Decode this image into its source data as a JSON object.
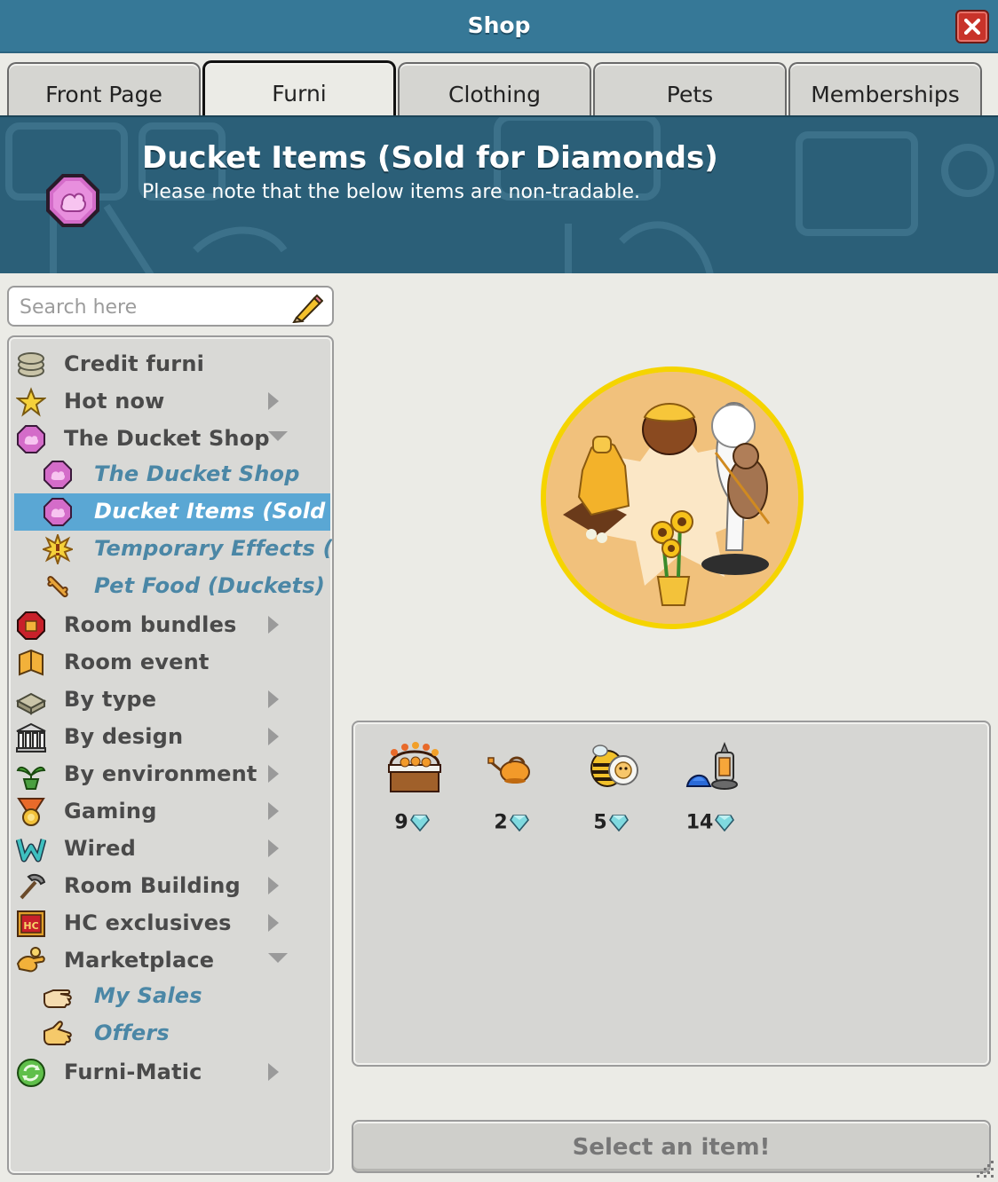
{
  "window": {
    "title": "Shop",
    "close_icon": "close-icon"
  },
  "tabs": [
    {
      "label": "Front Page",
      "active": false
    },
    {
      "label": "Furni",
      "active": true
    },
    {
      "label": "Clothing",
      "active": false
    },
    {
      "label": "Pets",
      "active": false
    },
    {
      "label": "Memberships",
      "active": false
    }
  ],
  "banner": {
    "title": "Ducket Items (Sold for Diamonds)",
    "subtitle": "Please note that the below items are non-tradable.",
    "icon": "ducket-icon"
  },
  "search": {
    "placeholder": "Search here",
    "value": "",
    "icon": "pencil-icon"
  },
  "categories": [
    {
      "label": "Credit furni",
      "icon": "credit-stack-icon",
      "arrow": "none",
      "level": 0
    },
    {
      "label": "Hot now",
      "icon": "star-icon",
      "arrow": "right",
      "level": 0
    },
    {
      "label": "The Ducket Shop",
      "icon": "ducket-icon",
      "arrow": "down",
      "level": 0
    },
    {
      "label": "The Ducket Shop",
      "icon": "ducket-icon",
      "arrow": "none",
      "level": 1
    },
    {
      "label": "Ducket Items (Sold for Diamonds)",
      "icon": "ducket-icon",
      "arrow": "none",
      "level": 1,
      "selected": true
    },
    {
      "label": "Temporary Effects (Duckets)",
      "icon": "burst-icon",
      "arrow": "none",
      "level": 1
    },
    {
      "label": "Pet Food (Duckets)",
      "icon": "bone-icon",
      "arrow": "none",
      "level": 1
    },
    {
      "label": "Room bundles",
      "icon": "bundle-icon",
      "arrow": "right",
      "level": 0
    },
    {
      "label": "Room event",
      "icon": "event-icon",
      "arrow": "none",
      "level": 0
    },
    {
      "label": "By type",
      "icon": "sofa-icon",
      "arrow": "right",
      "level": 0
    },
    {
      "label": "By design",
      "icon": "pillars-icon",
      "arrow": "right",
      "level": 0
    },
    {
      "label": "By environment",
      "icon": "plant-icon",
      "arrow": "right",
      "level": 0
    },
    {
      "label": "Gaming",
      "icon": "medal-icon",
      "arrow": "right",
      "level": 0
    },
    {
      "label": "Wired",
      "icon": "wired-icon",
      "arrow": "right",
      "level": 0
    },
    {
      "label": "Room Building",
      "icon": "hammer-icon",
      "arrow": "right",
      "level": 0
    },
    {
      "label": "HC exclusives",
      "icon": "hc-icon",
      "arrow": "right",
      "level": 0
    },
    {
      "label": "Marketplace",
      "icon": "market-icon",
      "arrow": "down",
      "level": 0
    },
    {
      "label": "My Sales",
      "icon": "hand-icon",
      "arrow": "none",
      "level": 1
    },
    {
      "label": "Offers",
      "icon": "hand-icon",
      "arrow": "none",
      "level": 1
    },
    {
      "label": "Furni-Matic",
      "icon": "recycle-icon",
      "arrow": "right",
      "level": 0
    }
  ],
  "preview": {
    "icon": "ducket-items-preview-image"
  },
  "items": [
    {
      "price": "9",
      "currency_icon": "diamond-icon",
      "icon": "fruit-stall-icon"
    },
    {
      "price": "2",
      "currency_icon": "diamond-icon",
      "icon": "watering-can-icon"
    },
    {
      "price": "5",
      "currency_icon": "diamond-icon",
      "icon": "bee-icon"
    },
    {
      "price": "14",
      "currency_icon": "diamond-icon",
      "icon": "lantern-hat-icon"
    }
  ],
  "action_button": {
    "label": "Select an item!"
  },
  "colors": {
    "titlebar": "#367897",
    "banner": "#2b5f78",
    "selected": "#5aa7d4",
    "sub_label": "#4b87a6",
    "diamond": "#7fd9df"
  }
}
